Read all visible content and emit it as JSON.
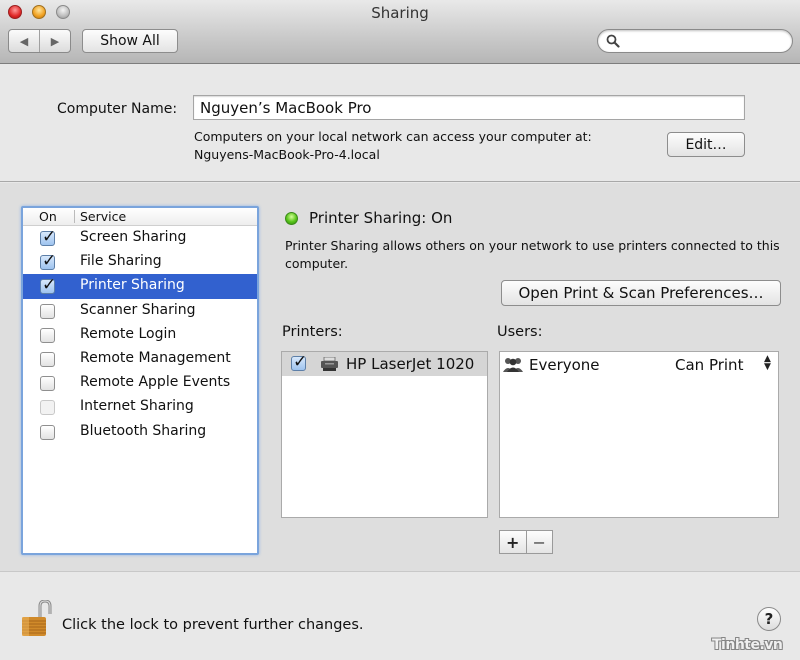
{
  "window": {
    "title": "Sharing",
    "show_all_label": "Show All",
    "back_glyph": "◀",
    "forward_glyph": "▶",
    "search_placeholder": ""
  },
  "computer_name": {
    "label": "Computer Name:",
    "value": "Nguyen’s MacBook Pro",
    "info_line1": "Computers on your local network can access your computer at:",
    "info_line2": "Nguyens-MacBook-Pro-4.local",
    "edit_label": "Edit…"
  },
  "services": {
    "header_on": "On",
    "header_service": "Service",
    "items": [
      {
        "label": "Screen Sharing",
        "on": true,
        "selected": false,
        "enabled": true
      },
      {
        "label": "File Sharing",
        "on": true,
        "selected": false,
        "enabled": true
      },
      {
        "label": "Printer Sharing",
        "on": true,
        "selected": true,
        "enabled": true
      },
      {
        "label": "Scanner Sharing",
        "on": false,
        "selected": false,
        "enabled": true
      },
      {
        "label": "Remote Login",
        "on": false,
        "selected": false,
        "enabled": true
      },
      {
        "label": "Remote Management",
        "on": false,
        "selected": false,
        "enabled": true
      },
      {
        "label": "Remote Apple Events",
        "on": false,
        "selected": false,
        "enabled": true
      },
      {
        "label": "Internet Sharing",
        "on": false,
        "selected": false,
        "enabled": false
      },
      {
        "label": "Bluetooth Sharing",
        "on": false,
        "selected": false,
        "enabled": true
      }
    ]
  },
  "detail": {
    "status_title": "Printer Sharing: On",
    "status_color": "#58c41a",
    "description": "Printer Sharing allows others on your network to use printers connected to this computer.",
    "open_prefs_label": "Open Print & Scan Preferences…",
    "printers_label": "Printers:",
    "users_label": "Users:",
    "printers": [
      {
        "name": "HP LaserJet 1020",
        "checked": true
      }
    ],
    "users": [
      {
        "name": "Everyone",
        "permission": "Can Print"
      }
    ],
    "add_label": "+",
    "remove_label": "−"
  },
  "footer": {
    "lock_text": "Click the lock to prevent further changes.",
    "help_label": "?",
    "watermark": "Tinhte.vn"
  },
  "colors": {
    "selection": "#3261cf",
    "focus_ring": "#7aa4dc"
  }
}
